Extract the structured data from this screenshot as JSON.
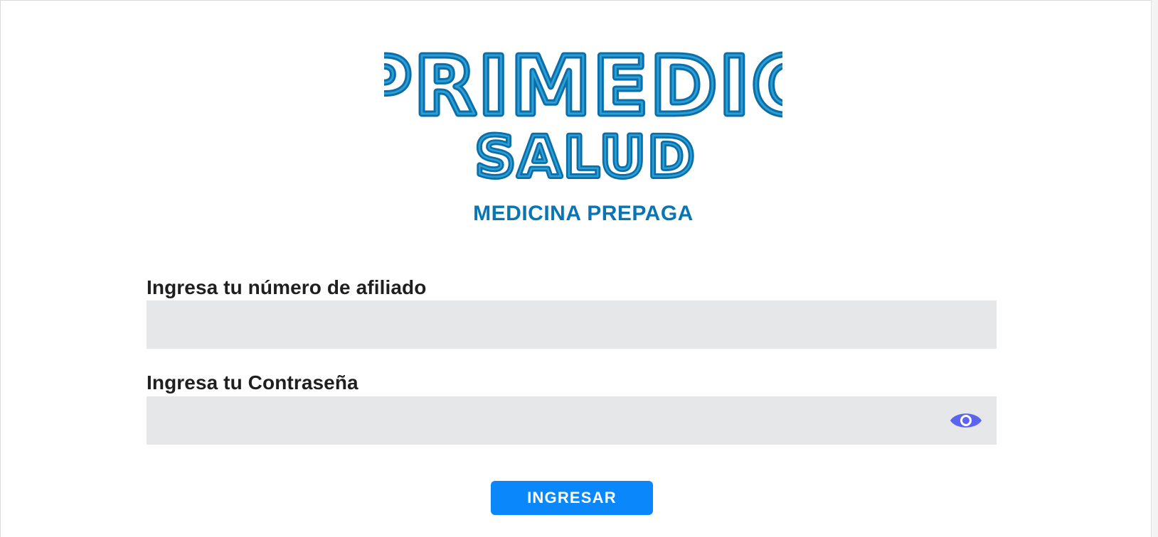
{
  "logo": {
    "line1": "PRIMEDIC",
    "line2": "SALUD",
    "line3": "MEDICINA PREPAGA",
    "color_outer": "#0b6ea8",
    "color_inner": "#2a9fd6",
    "color_tagline": "#0b74b3"
  },
  "form": {
    "afiliado_label": "Ingresa tu número de afiliado",
    "afiliado_value": "",
    "afiliado_placeholder": "",
    "password_label": "Ingresa tu Contraseña",
    "password_value": "",
    "password_placeholder": "",
    "eye_icon": "eye-icon",
    "eye_color": "#5a64f0",
    "submit_label": "INGRESAR",
    "submit_color": "#0a87fb"
  }
}
